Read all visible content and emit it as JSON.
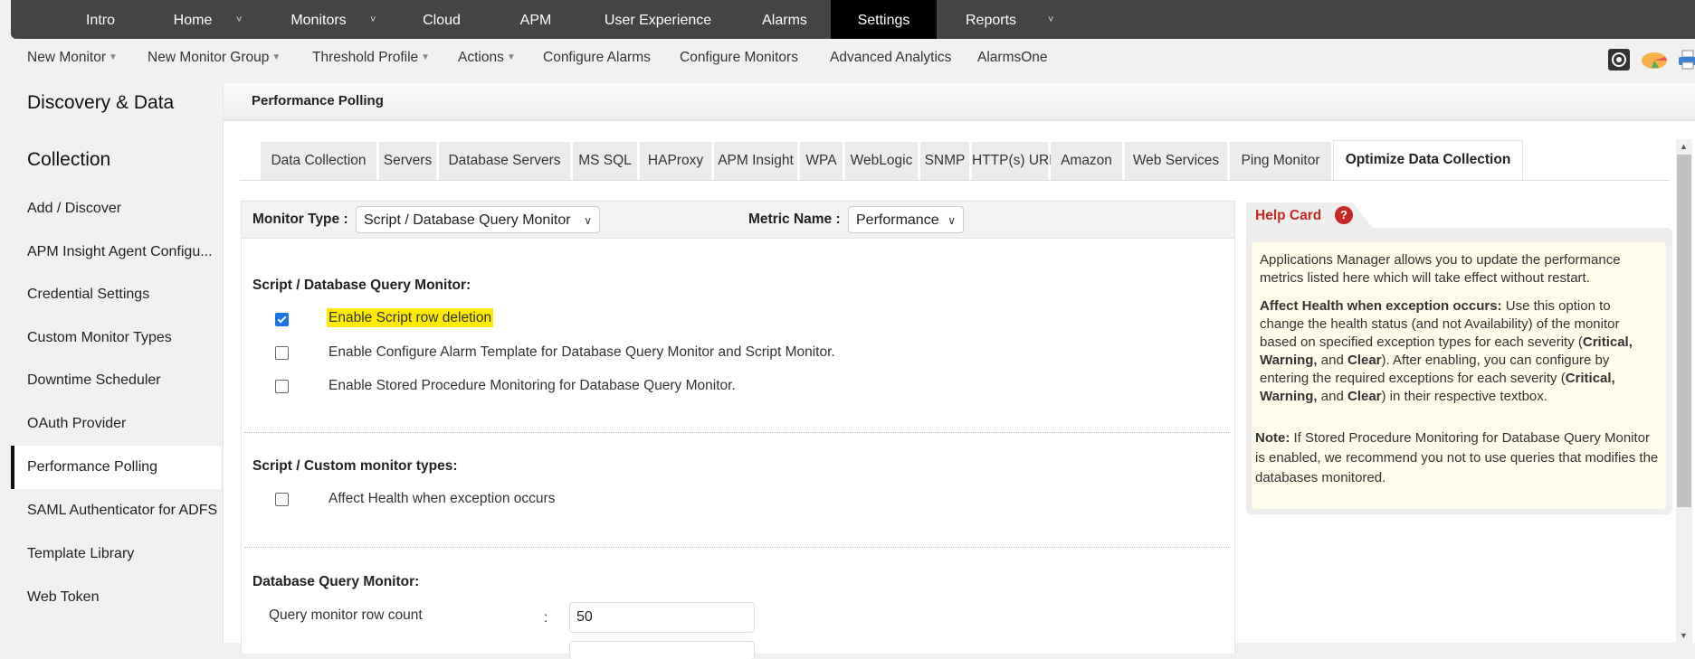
{
  "topnav": {
    "items": [
      {
        "label": "Intro"
      },
      {
        "label": "Home",
        "has_dropdown": true
      },
      {
        "label": "Monitors",
        "has_dropdown": true
      },
      {
        "label": "Cloud"
      },
      {
        "label": "APM"
      },
      {
        "label": "User Experience"
      },
      {
        "label": "Alarms"
      },
      {
        "label": "Settings",
        "active": true
      },
      {
        "label": "Reports",
        "has_dropdown": true
      }
    ],
    "caret_glyph": "˅"
  },
  "toolbar": {
    "items": [
      {
        "label": "New Monitor",
        "dropdown": true
      },
      {
        "label": "New Monitor Group",
        "dropdown": true
      },
      {
        "label": "Threshold Profile",
        "dropdown": true
      },
      {
        "label": "Actions",
        "dropdown": true
      },
      {
        "label": "Configure Alarms"
      },
      {
        "label": "Configure Monitors"
      },
      {
        "label": "Advanced Analytics"
      },
      {
        "label": "AlarmsOne"
      }
    ],
    "caret_glyph": "▼",
    "icons": [
      "camera-shutter-icon",
      "pie-chart-icon",
      "printer-icon"
    ]
  },
  "sidebar": {
    "heading_line1": "Discovery & Data",
    "heading_line2": "Collection",
    "items": [
      {
        "label": "Add / Discover"
      },
      {
        "label": "APM Insight Agent Configu..."
      },
      {
        "label": "Credential Settings"
      },
      {
        "label": "Custom Monitor Types"
      },
      {
        "label": "Downtime Scheduler"
      },
      {
        "label": "OAuth Provider"
      },
      {
        "label": "Performance Polling",
        "active": true
      },
      {
        "label": "SAML Authenticator for ADFS"
      },
      {
        "label": "Template Library"
      },
      {
        "label": "Web Token"
      }
    ]
  },
  "main": {
    "title": "Performance Polling",
    "tabs": [
      {
        "label": "Data Collection"
      },
      {
        "label": "Servers"
      },
      {
        "label": "Database Servers"
      },
      {
        "label": "MS SQL"
      },
      {
        "label": "HAProxy"
      },
      {
        "label": "APM Insight"
      },
      {
        "label": "WPA"
      },
      {
        "label": "WebLogic"
      },
      {
        "label": "SNMP"
      },
      {
        "label": "HTTP(s) URLs"
      },
      {
        "label": "Amazon"
      },
      {
        "label": "Web Services"
      },
      {
        "label": "Ping Monitor"
      },
      {
        "label": "Optimize Data Collection",
        "active": true
      }
    ]
  },
  "form": {
    "monitor_type_label": "Monitor Type :",
    "monitor_type_value": "Script / Database Query Monitor",
    "metric_name_label": "Metric Name :",
    "metric_name_value": "Performance",
    "section1_title": "Script / Database Query Monitor:",
    "section1_options": [
      {
        "label": "Enable Script row deletion",
        "checked": true,
        "highlighted": true
      },
      {
        "label": "Enable Configure Alarm Template for Database Query Monitor and Script Monitor.",
        "checked": false
      },
      {
        "label": "Enable Stored Procedure Monitoring for Database Query Monitor.",
        "checked": false
      }
    ],
    "section2_title": "Script / Custom monitor types:",
    "section2_options": [
      {
        "label": "Affect Health when exception occurs",
        "checked": false
      }
    ],
    "section3_title": "Database Query Monitor:",
    "row_count_label": "Query monitor row count",
    "row_count_colon": ":",
    "row_count_value": "50"
  },
  "help": {
    "title": "Help Card",
    "icon_glyph": "?",
    "p1": "Applications Manager allows you to update the performance metrics listed here which will take effect without restart.",
    "p2_bold": "Affect Health when exception occurs:",
    "p2_a": " Use this option to change the health status (and not Availability) of the monitor based on specified exception types for each severity (",
    "p2_b1": "Critical, Warning,",
    "p2_c": " and ",
    "p2_b2": "Clear",
    "p2_d": "). After enabling, you can configure by entering the required exceptions for each severity (",
    "p2_b3": "Critical, Warning,",
    "p2_e": " and ",
    "p2_b4": "Clear",
    "p2_f": ") in their respective textbox.",
    "p3_bold": "Note:",
    "p3": " If Stored Procedure Monitoring for Database Query Monitor is enabled, we recommend you not to use queries that modifies the databases monitored."
  },
  "colors": {
    "topnav_bg": "#444444",
    "topnav_active": "#000000",
    "highlight": "#ffeb00",
    "help_title": "#c62828",
    "checkbox_checked": "#1a73e8",
    "help_bg": "#fffbeb"
  }
}
